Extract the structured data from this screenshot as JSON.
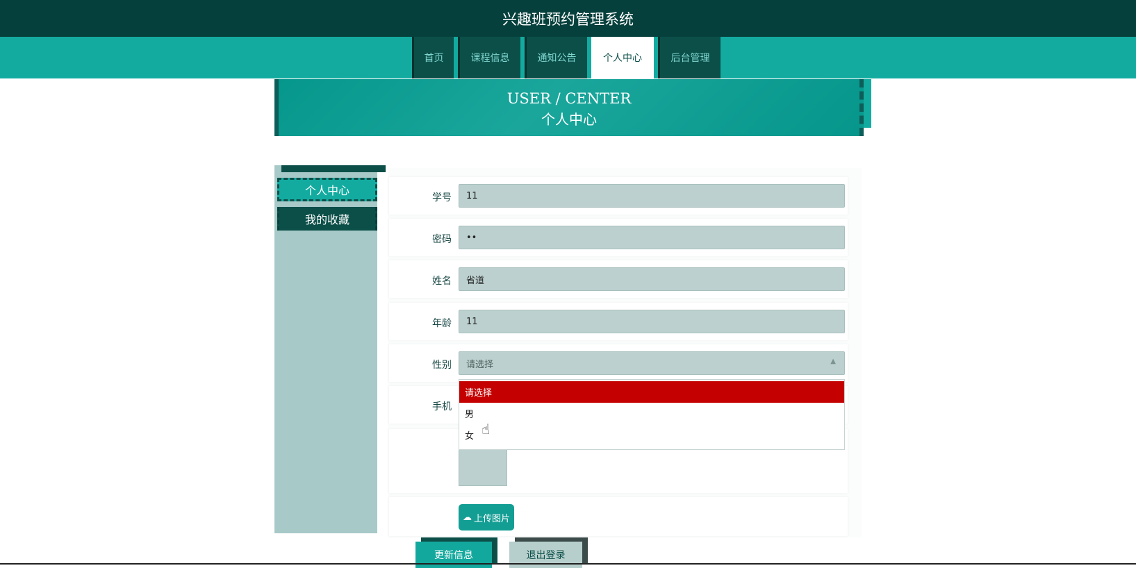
{
  "header": {
    "title": "兴趣班预约管理系统"
  },
  "nav": {
    "items": [
      {
        "label": "首页",
        "active": false
      },
      {
        "label": "课程信息",
        "active": false
      },
      {
        "label": "通知公告",
        "active": false
      },
      {
        "label": "个人中心",
        "active": true
      },
      {
        "label": "后台管理",
        "active": false
      }
    ]
  },
  "banner": {
    "title_en": "USER / CENTER",
    "title_cn": "个人中心"
  },
  "sidebar": {
    "items": [
      {
        "label": "个人中心",
        "active": true
      },
      {
        "label": "我的收藏",
        "active": false
      }
    ]
  },
  "form": {
    "student_id": {
      "label": "学号",
      "value": "11"
    },
    "password": {
      "label": "密码",
      "value": "••"
    },
    "name": {
      "label": "姓名",
      "value": "省道"
    },
    "age": {
      "label": "年龄",
      "value": "11"
    },
    "gender": {
      "label": "性别",
      "selected": "请选择",
      "options": [
        "请选择",
        "男",
        "女"
      ],
      "highlighted": "请选择"
    },
    "phone": {
      "label": "手机"
    },
    "upload_label": "上传图片",
    "update_label": "更新信息",
    "logout_label": "退出登录"
  },
  "colors": {
    "header_dark": "#06403c",
    "teal": "#13aba0",
    "nav_dark": "#0c4f49",
    "field_bg": "#bcd1cf",
    "option_highlight": "#c40000"
  }
}
